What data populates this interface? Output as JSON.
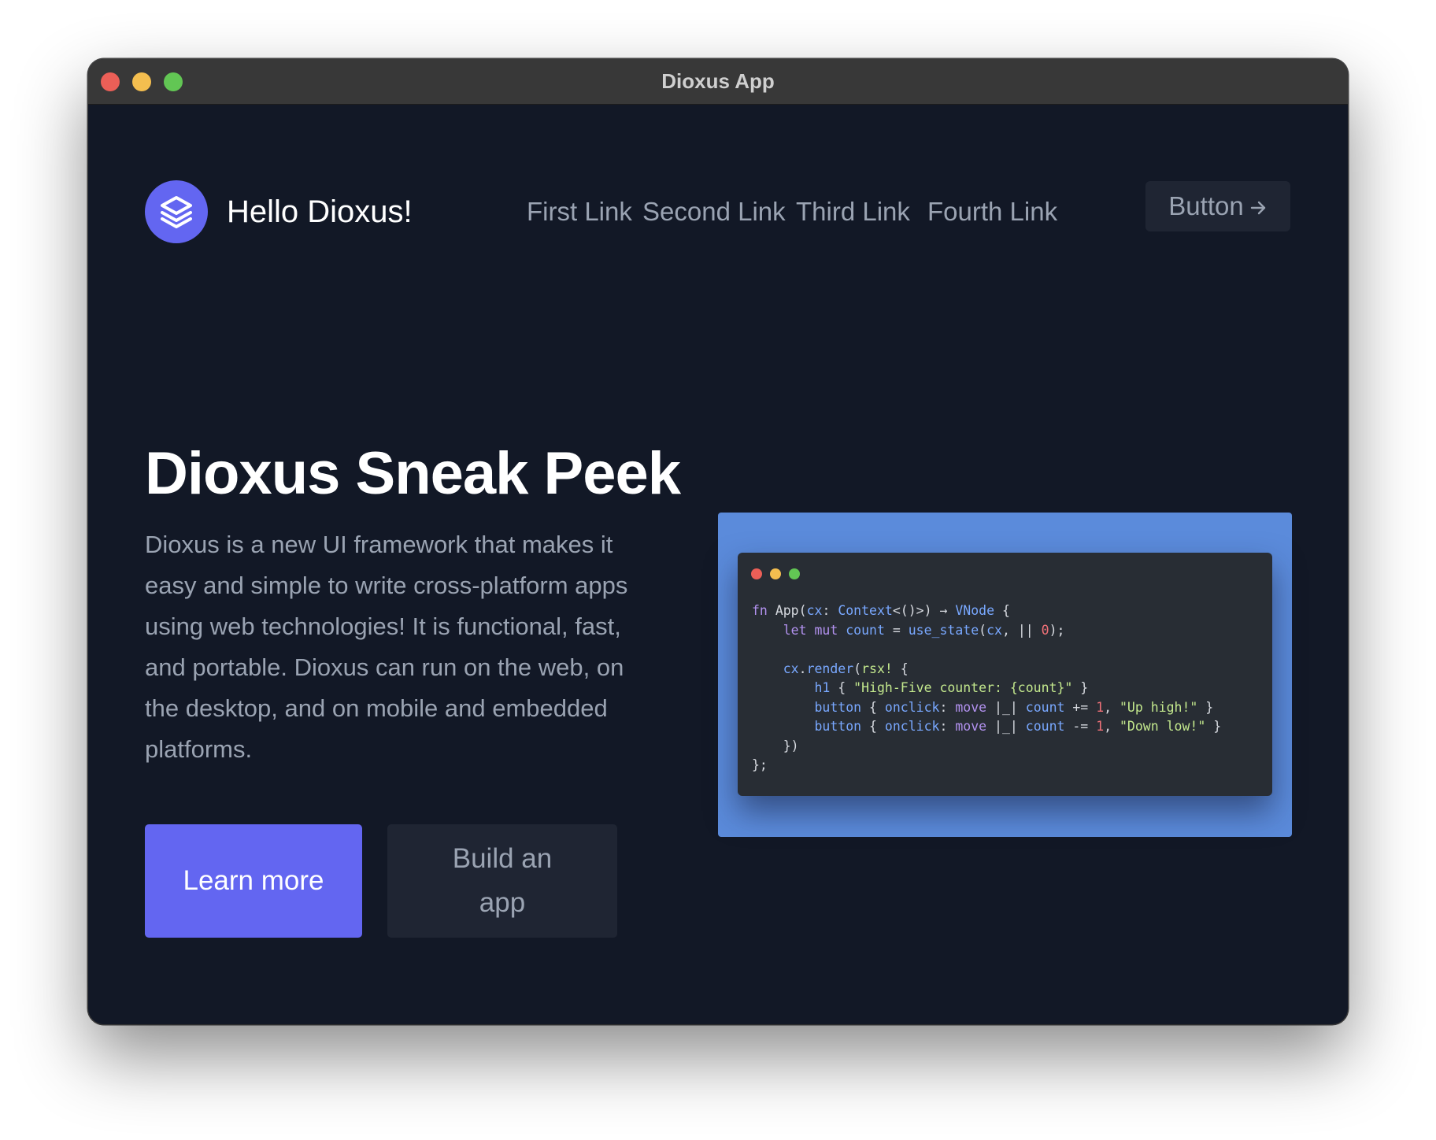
{
  "window": {
    "title": "Dioxus App"
  },
  "header": {
    "brand": "Hello Dioxus!",
    "logo_icon": "stack-layers-icon",
    "nav": [
      {
        "label": "First Link"
      },
      {
        "label": "Second Link"
      },
      {
        "label": "Third Link"
      },
      {
        "label": "Fourth Link"
      }
    ],
    "button_label": "Button",
    "button_icon": "arrow-right-icon"
  },
  "hero": {
    "title": "Dioxus Sneak Peek",
    "description": "Dioxus is a new UI framework that makes it easy and simple to write cross-platform apps using web technologies! It is functional, fast, and portable. Dioxus can run on the web, on the desktop, and on mobile and embedded platforms.",
    "primary_button": "Learn more",
    "secondary_button": "Build an app"
  },
  "code": {
    "lines": [
      "fn App(cx: Context<()>) → VNode {",
      "    let mut count = use_state(cx, || 0);",
      "",
      "    cx.render(rsx! {",
      "        h1 { \"High-Five counter: {count}\" }",
      "        button { onclick: move |_| count += 1, \"Up high!\" }",
      "        button { onclick: move |_| count -= 1, \"Down low!\" }",
      "    })",
      "};"
    ]
  },
  "colors": {
    "accent": "#6366f1",
    "background": "#121826",
    "code_panel": "#5b8bdb",
    "code_bg": "#282d34"
  }
}
